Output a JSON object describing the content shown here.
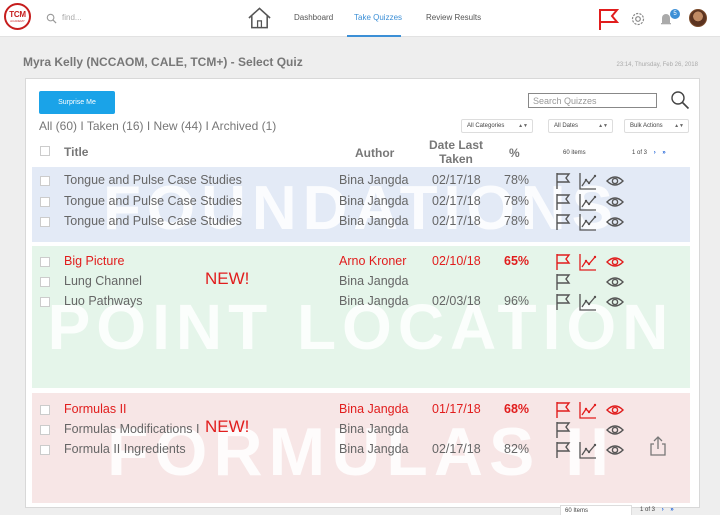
{
  "app": {
    "logo_line1": "TCM",
    "logo_line2": "ACADEMY"
  },
  "topbar": {
    "search_placeholder": "find...",
    "nav": [
      "Dashboard",
      "Take Quizzes",
      "Review Results"
    ],
    "notification_count": "5",
    "accent_color": "#3c8fd6",
    "flag_color": "#e11d1d"
  },
  "page": {
    "title": "Myra Kelly (NCCAOM, CALE, TCM+) - Select Quiz",
    "timestamp": "23:14, Thursday, Feb 26, 2018"
  },
  "toolbar": {
    "surprise_label": "Surprise Me",
    "search_placeholder": "Search Quizzes",
    "filters": [
      {
        "label": "All (60)"
      },
      {
        "label": "Taken (16)"
      },
      {
        "label": "New (44)"
      },
      {
        "label": "Archived (1)"
      }
    ],
    "separator": " I ",
    "category_select": "All Categories",
    "date_select": "All Dates",
    "bulk_select": "Bulk Actions"
  },
  "table": {
    "headers": {
      "title": "Title",
      "author": "Author",
      "date": "Date Last Taken",
      "pct": "%"
    },
    "items_label": "60 items",
    "pager": {
      "current": "1",
      "of": "of 3",
      "next": "›",
      "last": "»"
    }
  },
  "sections": [
    {
      "watermark": "FOUNDATIONS",
      "color": "#e3eaf6",
      "rows": [
        {
          "title": "Tongue and Pulse Case Studies",
          "author": "Bina Jangda",
          "date": "02/17/18",
          "pct": "78%",
          "hot": false,
          "new": ""
        },
        {
          "title": "Tongue and Pulse Case Studies",
          "author": "Bina Jangda",
          "date": "02/17/18",
          "pct": "78%",
          "hot": false,
          "new": ""
        },
        {
          "title": "Tongue and Pulse Case Studies",
          "author": "Bina Jangda",
          "date": "02/17/18",
          "pct": "78%",
          "hot": false,
          "new": ""
        }
      ]
    },
    {
      "watermark": "POINT LOCATION",
      "color": "#e5f5ea",
      "rows": [
        {
          "title": "Big Picture",
          "author": "Arno Kroner",
          "date": "02/10/18",
          "pct": "65%",
          "hot": true,
          "new": ""
        },
        {
          "title": "Lung Channel",
          "author": "Bina Jangda",
          "date": "",
          "pct": "",
          "hot": false,
          "new": "NEW!"
        },
        {
          "title": "Luo Pathways",
          "author": "Bina Jangda",
          "date": "02/03/18",
          "pct": "96%",
          "hot": false,
          "new": ""
        }
      ]
    },
    {
      "watermark": "FORMULAS II",
      "color": "#f7e6e6",
      "rows": [
        {
          "title": "Formulas II",
          "author": "Bina Jangda",
          "date": "01/17/18",
          "pct": "68%",
          "hot": true,
          "new": ""
        },
        {
          "title": "Formulas Modifications I",
          "author": "Bina Jangda",
          "date": "",
          "pct": "",
          "hot": false,
          "new": "NEW!"
        },
        {
          "title": "Formula II Ingredients",
          "author": "Bina Jangda",
          "date": "02/17/18",
          "pct": "82%",
          "hot": false,
          "new": ""
        }
      ]
    }
  ],
  "footer": {
    "items_label": "60 Items",
    "pager_current": "1",
    "pager_of": "of 3",
    "pager_next": "›",
    "pager_last": "»"
  }
}
